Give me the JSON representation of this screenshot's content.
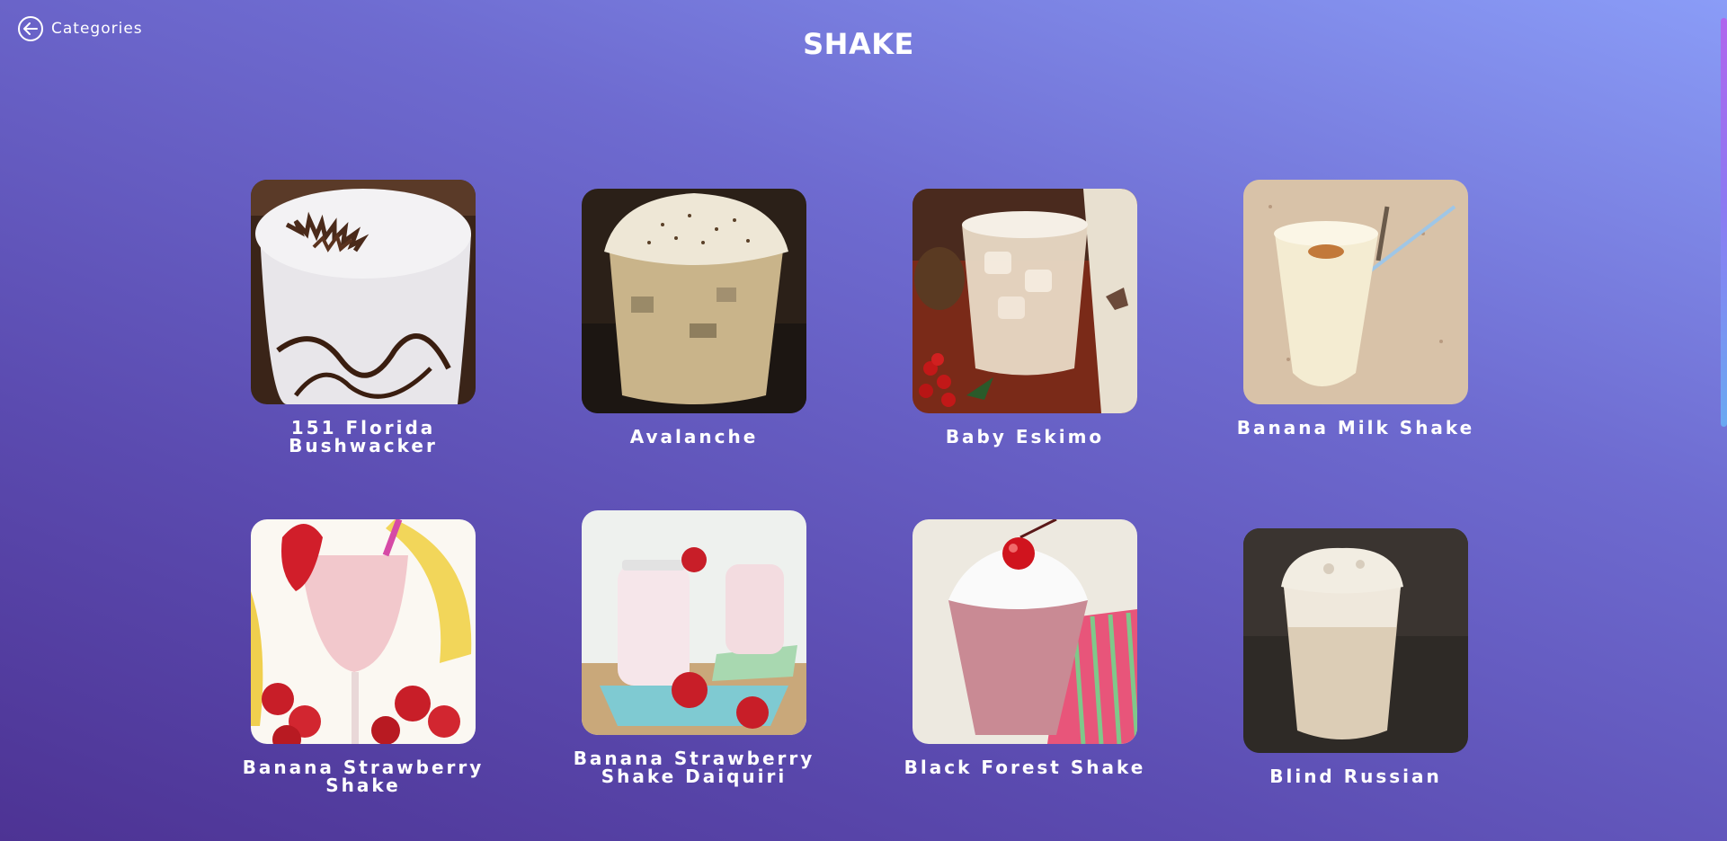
{
  "nav": {
    "back_label": "Categories"
  },
  "page": {
    "title": "SHAKE"
  },
  "drinks": [
    {
      "name": "151 Florida Bushwacker"
    },
    {
      "name": "Avalanche"
    },
    {
      "name": "Baby Eskimo"
    },
    {
      "name": "Banana Milk Shake"
    },
    {
      "name": "Banana Strawberry Shake"
    },
    {
      "name": "Banana Strawberry Shake Daiquiri"
    },
    {
      "name": "Black Forest Shake"
    },
    {
      "name": "Blind Russian"
    }
  ]
}
